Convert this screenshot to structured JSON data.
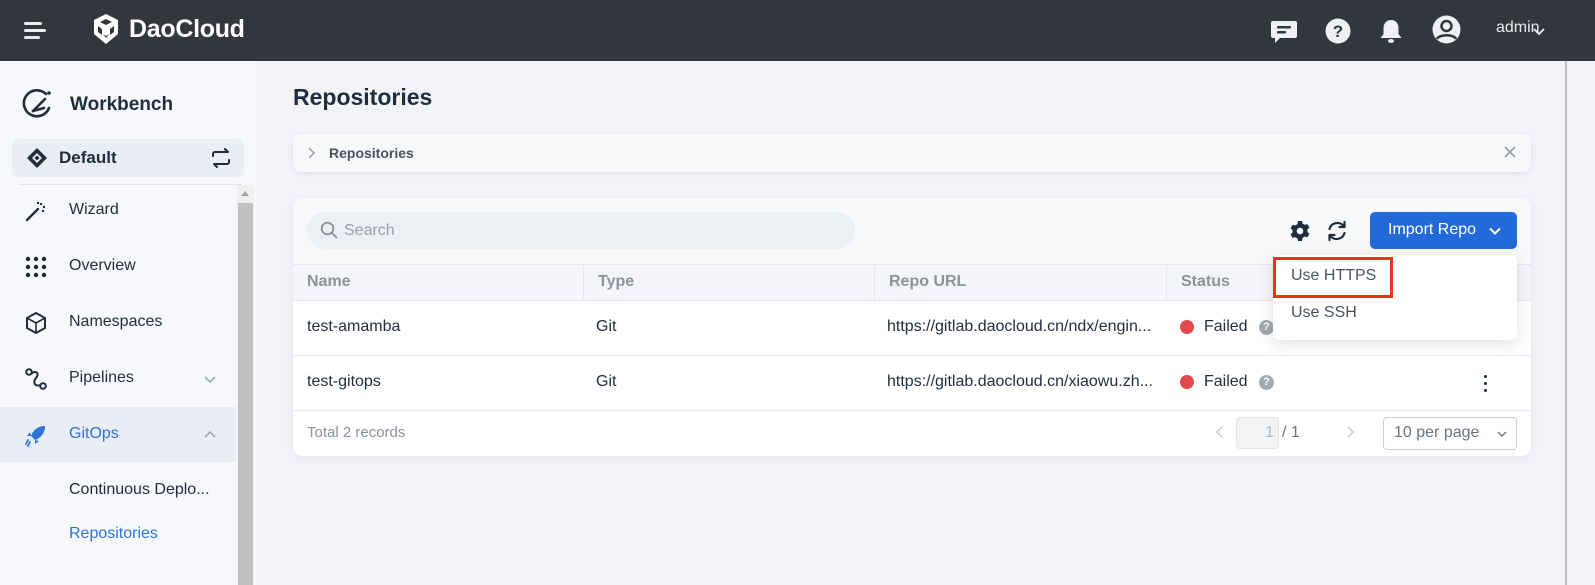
{
  "header": {
    "brand": "DaoCloud",
    "icons": [
      "menu-icon",
      "message-icon",
      "help-icon",
      "bell-icon",
      "user-avatar-icon"
    ],
    "user": "admin"
  },
  "sidebar": {
    "title": "Workbench",
    "workspace": "Default",
    "items": [
      {
        "label": "Wizard",
        "icon": "magic-wand-icon"
      },
      {
        "label": "Overview",
        "icon": "grid-icon"
      },
      {
        "label": "Namespaces",
        "icon": "cube-icon"
      },
      {
        "label": "Pipelines",
        "icon": "pipeline-icon",
        "expandable": true,
        "expanded": false
      },
      {
        "label": "GitOps",
        "icon": "rocket-icon",
        "expandable": true,
        "expanded": true,
        "active": true
      }
    ],
    "subitems": [
      {
        "label": "Continuous Deplo...",
        "active": false
      },
      {
        "label": "Repositories",
        "active": true
      }
    ]
  },
  "page": {
    "title": "Repositories",
    "breadcrumb": "Repositories"
  },
  "toolbar": {
    "search_placeholder": "Search",
    "import_label": "Import Repo",
    "dropdown": [
      "Use HTTPS",
      "Use SSH"
    ]
  },
  "table": {
    "columns": [
      "Name",
      "Type",
      "Repo URL",
      "Status"
    ],
    "rows": [
      {
        "name": "test-amamba",
        "type": "Git",
        "url": "https://gitlab.daocloud.cn/ndx/engin...",
        "status": "Failed"
      },
      {
        "name": "test-gitops",
        "type": "Git",
        "url": "https://gitlab.daocloud.cn/xiaowu.zh...",
        "status": "Failed"
      }
    ],
    "help_glyph": "?"
  },
  "pagination": {
    "total": "Total 2 records",
    "current": "1",
    "of": "/ 1",
    "page_size": "10 per page"
  },
  "colors": {
    "primary": "#2369d8",
    "active_nav": "#2e73d6",
    "failed": "#e5484d",
    "highlight": "#e8341c",
    "header_bg": "#33363c"
  }
}
